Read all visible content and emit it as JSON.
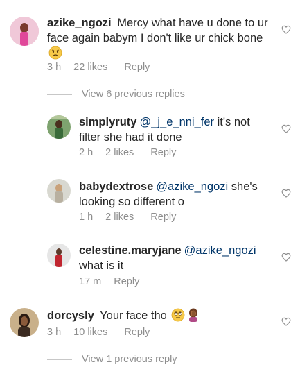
{
  "comments": [
    {
      "username": "azike_ngozi",
      "text": " Mercy what have u done to ur face again babym I don't like ur chick bone",
      "time": "3 h",
      "likes": "22 likes",
      "reply": "Reply"
    },
    {
      "username": "simplyruty",
      "mention": "@_j_e_nni_fer",
      "text": " it's not filter she had it done",
      "time": "2 h",
      "likes": "2 likes",
      "reply": "Reply"
    },
    {
      "username": "babydextrose",
      "mention": "@azike_ngozi",
      "text": " she's looking so different o",
      "time": "1 h",
      "likes": "2 likes",
      "reply": "Reply"
    },
    {
      "username": "celestine.maryjane",
      "mention": "@azike_ngozi",
      "text": "what is it",
      "time": "17 m",
      "reply": "Reply"
    },
    {
      "username": "dorcysly",
      "text": " Your face tho ",
      "time": "3 h",
      "likes": "10 likes",
      "reply": "Reply"
    }
  ],
  "view_replies": [
    {
      "label": "View 6 previous replies"
    },
    {
      "label": "View 1 previous reply"
    }
  ],
  "icons": {
    "heart": "heart-outline-icon",
    "emoji_sad": "sad-face-emoji",
    "emoji_rolling": "eye-roll-emoji",
    "emoji_facepalm": "facepalm-emoji"
  },
  "colors": {
    "text": "#262626",
    "muted": "#8e8e8e",
    "mention": "#003569",
    "divider": "#c7c7c7"
  }
}
